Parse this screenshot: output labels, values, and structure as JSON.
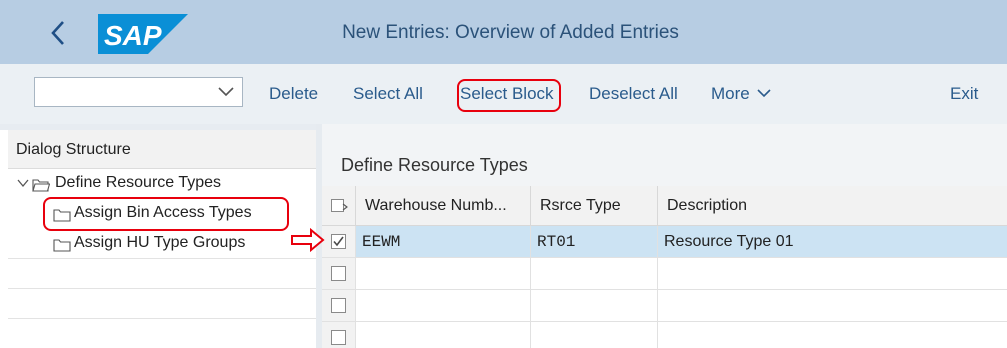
{
  "header": {
    "back_glyph": "<",
    "logo_text": "SAP",
    "title": "New Entries: Overview of Added Entries",
    "colors": {
      "bar": "#b7cde3",
      "logo": "#0a8fd6"
    }
  },
  "toolbar": {
    "dropdown_value": "",
    "delete": "Delete",
    "select_all": "Select All",
    "select_block": "Select Block",
    "deselect_all": "Deselect All",
    "more": "More",
    "exit": "Exit"
  },
  "dialog_structure": {
    "header": "Dialog Structure",
    "items": [
      {
        "label": "Define Resource Types",
        "icon": "folder-open-icon",
        "expanded": true
      },
      {
        "label": "Assign Bin Access Types",
        "icon": "folder-icon"
      },
      {
        "label": "Assign HU Type Groups",
        "icon": "folder-icon"
      }
    ]
  },
  "table": {
    "title": "Define Resource Types",
    "columns": [
      "Warehouse Numb...",
      "Rsrce Type",
      "Description"
    ],
    "rows": [
      {
        "selected": true,
        "warehouse": "EEWM",
        "type": "RT01",
        "description": "Resource Type 01"
      },
      {
        "selected": false,
        "warehouse": "",
        "type": "",
        "description": ""
      },
      {
        "selected": false,
        "warehouse": "",
        "type": "",
        "description": ""
      },
      {
        "selected": false,
        "warehouse": "",
        "type": "",
        "description": ""
      }
    ]
  },
  "annotations": {
    "highlight_color": "#e8000d"
  }
}
